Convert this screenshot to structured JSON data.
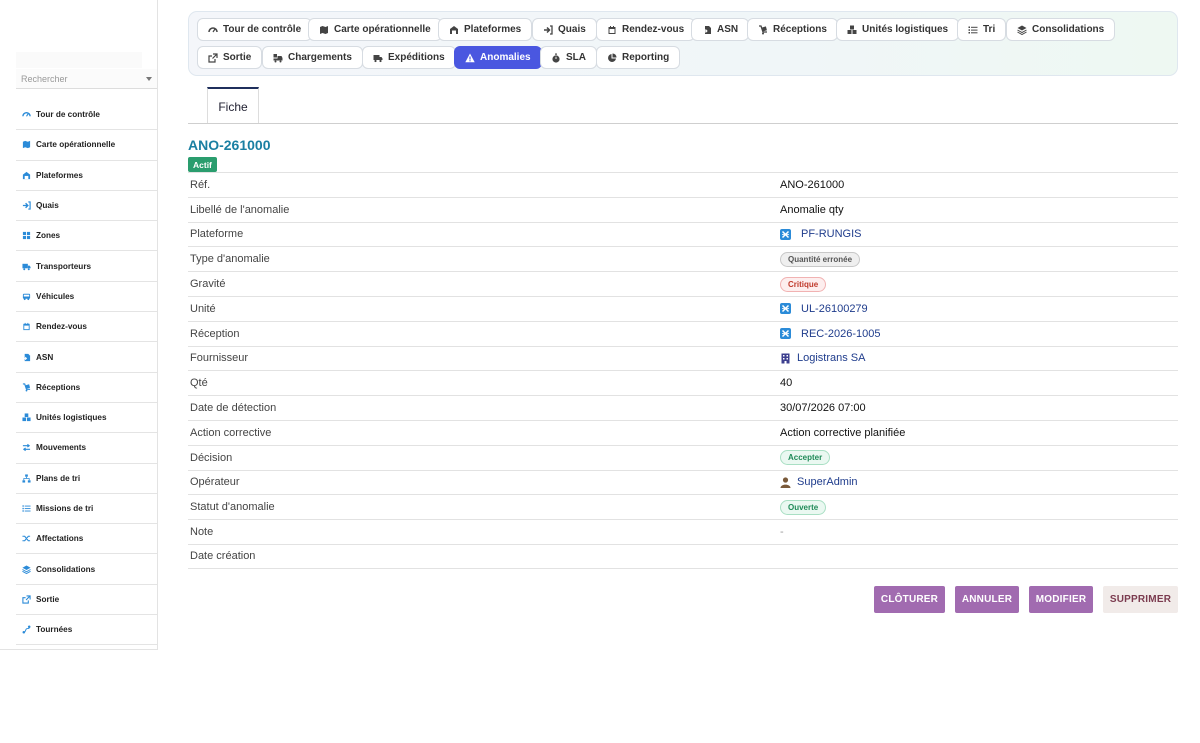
{
  "sidebar": {
    "search_placeholder": "Rechercher",
    "items": [
      {
        "label": "Tour de contrôle",
        "icon": "gauge-icon"
      },
      {
        "label": "Carte opérationnelle",
        "icon": "map-icon"
      },
      {
        "label": "Plateformes",
        "icon": "warehouse-icon"
      },
      {
        "label": "Quais",
        "icon": "sign-in-icon"
      },
      {
        "label": "Zones",
        "icon": "grid-icon"
      },
      {
        "label": "Transporteurs",
        "icon": "truck-icon"
      },
      {
        "label": "Véhicules",
        "icon": "bus-icon"
      },
      {
        "label": "Rendez-vous",
        "icon": "calendar-icon"
      },
      {
        "label": "ASN",
        "icon": "file-import-icon"
      },
      {
        "label": "Réceptions",
        "icon": "dolly-icon"
      },
      {
        "label": "Unités logistiques",
        "icon": "boxes-icon"
      },
      {
        "label": "Mouvements",
        "icon": "exchange-icon"
      },
      {
        "label": "Plans de tri",
        "icon": "sitemap-icon"
      },
      {
        "label": "Missions de tri",
        "icon": "list-icon"
      },
      {
        "label": "Affectations",
        "icon": "shuffle-icon"
      },
      {
        "label": "Consolidations",
        "icon": "layers-icon"
      },
      {
        "label": "Sortie",
        "icon": "external-link-icon"
      },
      {
        "label": "Tournées",
        "icon": "route-icon"
      }
    ]
  },
  "topnav": [
    {
      "label": "Tour de contrôle",
      "icon": "gauge-icon"
    },
    {
      "label": "Carte opérationnelle",
      "icon": "map-icon"
    },
    {
      "label": "Plateformes",
      "icon": "warehouse-icon"
    },
    {
      "label": "Quais",
      "icon": "sign-in-icon"
    },
    {
      "label": "Rendez-vous",
      "icon": "calendar-icon"
    },
    {
      "label": "ASN",
      "icon": "file-import-icon"
    },
    {
      "label": "Réceptions",
      "icon": "dolly-icon"
    },
    {
      "label": "Unités logistiques",
      "icon": "boxes-icon"
    },
    {
      "label": "Tri",
      "icon": "list-icon"
    },
    {
      "label": "Consolidations",
      "icon": "layers-icon"
    },
    {
      "label": "Sortie",
      "icon": "external-link-icon"
    },
    {
      "label": "Chargements",
      "icon": "truck-loading-icon"
    },
    {
      "label": "Expéditions",
      "icon": "shipping-icon"
    },
    {
      "label": "Anomalies",
      "icon": "warning-icon",
      "active": true
    },
    {
      "label": "SLA",
      "icon": "stopwatch-icon"
    },
    {
      "label": "Reporting",
      "icon": "pie-chart-icon"
    }
  ],
  "tabs": {
    "fiche": "Fiche"
  },
  "record": {
    "title": "ANO-261000",
    "status": "Actif"
  },
  "fields": {
    "ref": {
      "label": "Réf.",
      "value": "ANO-261000"
    },
    "libelle": {
      "label": "Libellé de l'anomalie",
      "value": "Anomalie qty"
    },
    "plateforme": {
      "label": "Plateforme",
      "value": "PF-RUNGIS"
    },
    "type": {
      "label": "Type d'anomalie",
      "value": "Quantité erronée"
    },
    "gravite": {
      "label": "Gravité",
      "value": "Critique"
    },
    "unite": {
      "label": "Unité",
      "value": "UL-26100279"
    },
    "reception": {
      "label": "Réception",
      "value": "REC-2026-1005"
    },
    "fournisseur": {
      "label": "Fournisseur",
      "value": "Logistrans SA"
    },
    "qte": {
      "label": "Qté",
      "value": "40"
    },
    "date_detection": {
      "label": "Date de détection",
      "value": "30/07/2026 07:00"
    },
    "action": {
      "label": "Action corrective",
      "value": "Action corrective planifiée"
    },
    "decision": {
      "label": "Décision",
      "value": "Accepter"
    },
    "operateur": {
      "label": "Opérateur",
      "value": "SuperAdmin"
    },
    "statut": {
      "label": "Statut d'anomalie",
      "value": "Ouverte"
    },
    "note": {
      "label": "Note",
      "value": "-"
    },
    "date_creation": {
      "label": "Date création",
      "value": ""
    }
  },
  "actions": {
    "cloturer": "CLÔTURER",
    "annuler": "ANNULER",
    "modifier": "MODIFIER",
    "supprimer": "SUPPRIMER"
  },
  "colors": {
    "accent": "#4a57e0",
    "title": "#1a7fa2",
    "status_green": "#2a9d6e",
    "button_purple": "#a16bb0",
    "link_icon": "#2b8bd8"
  }
}
